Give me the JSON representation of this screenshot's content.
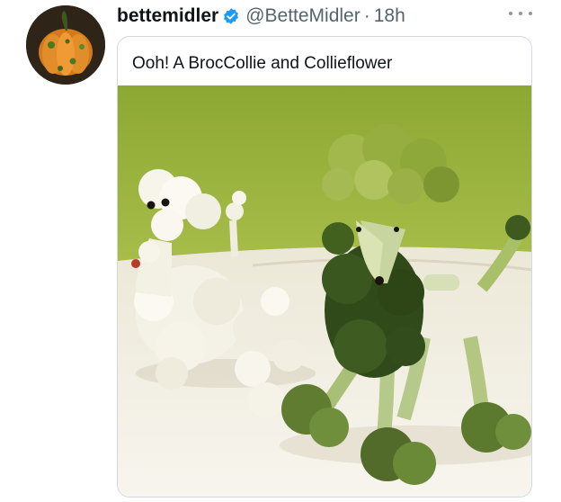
{
  "tweet": {
    "display_name": "bettemidler",
    "handle": "@BetteMidler",
    "separator": "·",
    "time": "18h",
    "avatar_icon": "pumpkin-avatar",
    "verified_icon": "verified-badge-icon",
    "more_icon": "more-options-icon",
    "quoted_text": "Ooh! A BrocCollie and Collieflower",
    "image_subject": "cauliflower poodle and broccoli poodle",
    "colors": {
      "accent_blue": "#1d9bf0",
      "text_primary": "#0f1419",
      "text_secondary": "#536471",
      "border": "#cfd9de",
      "photo_wall": "#9bb23e",
      "photo_table": "#f3f1e9"
    }
  }
}
